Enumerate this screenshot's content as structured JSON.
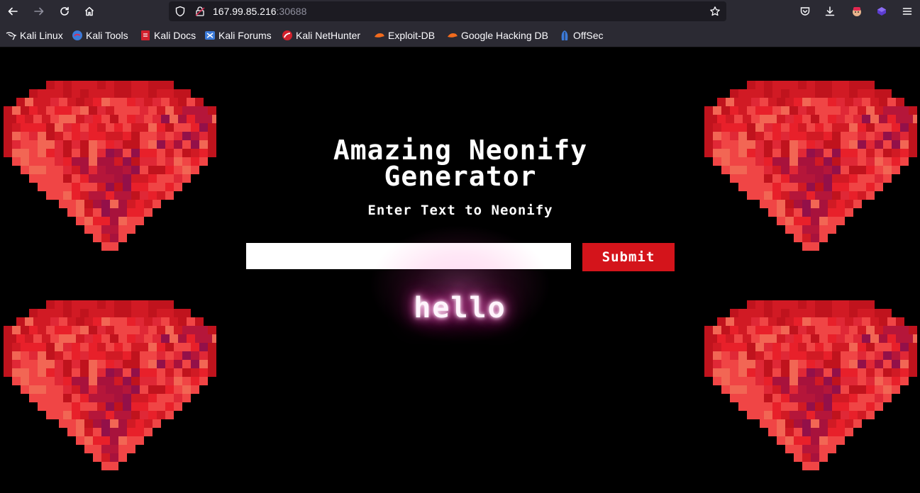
{
  "browser": {
    "url_host": "167.99.85.216",
    "url_port": ":30688",
    "bookmarks": [
      {
        "label": "Kali Linux",
        "icon": "kali-dragon-icon"
      },
      {
        "label": "Kali Tools",
        "icon": "kali-tools-icon"
      },
      {
        "label": "Kali Docs",
        "icon": "kali-docs-icon"
      },
      {
        "label": "Kali Forums",
        "icon": "kali-forums-icon"
      },
      {
        "label": "Kali NetHunter",
        "icon": "nethunter-icon"
      },
      {
        "label": "Exploit-DB",
        "icon": "exploit-db-icon"
      },
      {
        "label": "Google Hacking DB",
        "icon": "ghdb-icon"
      },
      {
        "label": "OffSec",
        "icon": "offsec-icon"
      }
    ]
  },
  "page": {
    "title_line1": "Amazing Neonify",
    "title_line2": "Generator",
    "subtitle": "Enter Text to Neonify",
    "input_value": "",
    "submit_label": "Submit",
    "output_text": "hello"
  },
  "colors": {
    "background": "#000000",
    "button": "#d4141b",
    "neon_glow": "#ff3fb7",
    "gem_red": "#e8202a",
    "gem_dark": "#a8123c"
  }
}
